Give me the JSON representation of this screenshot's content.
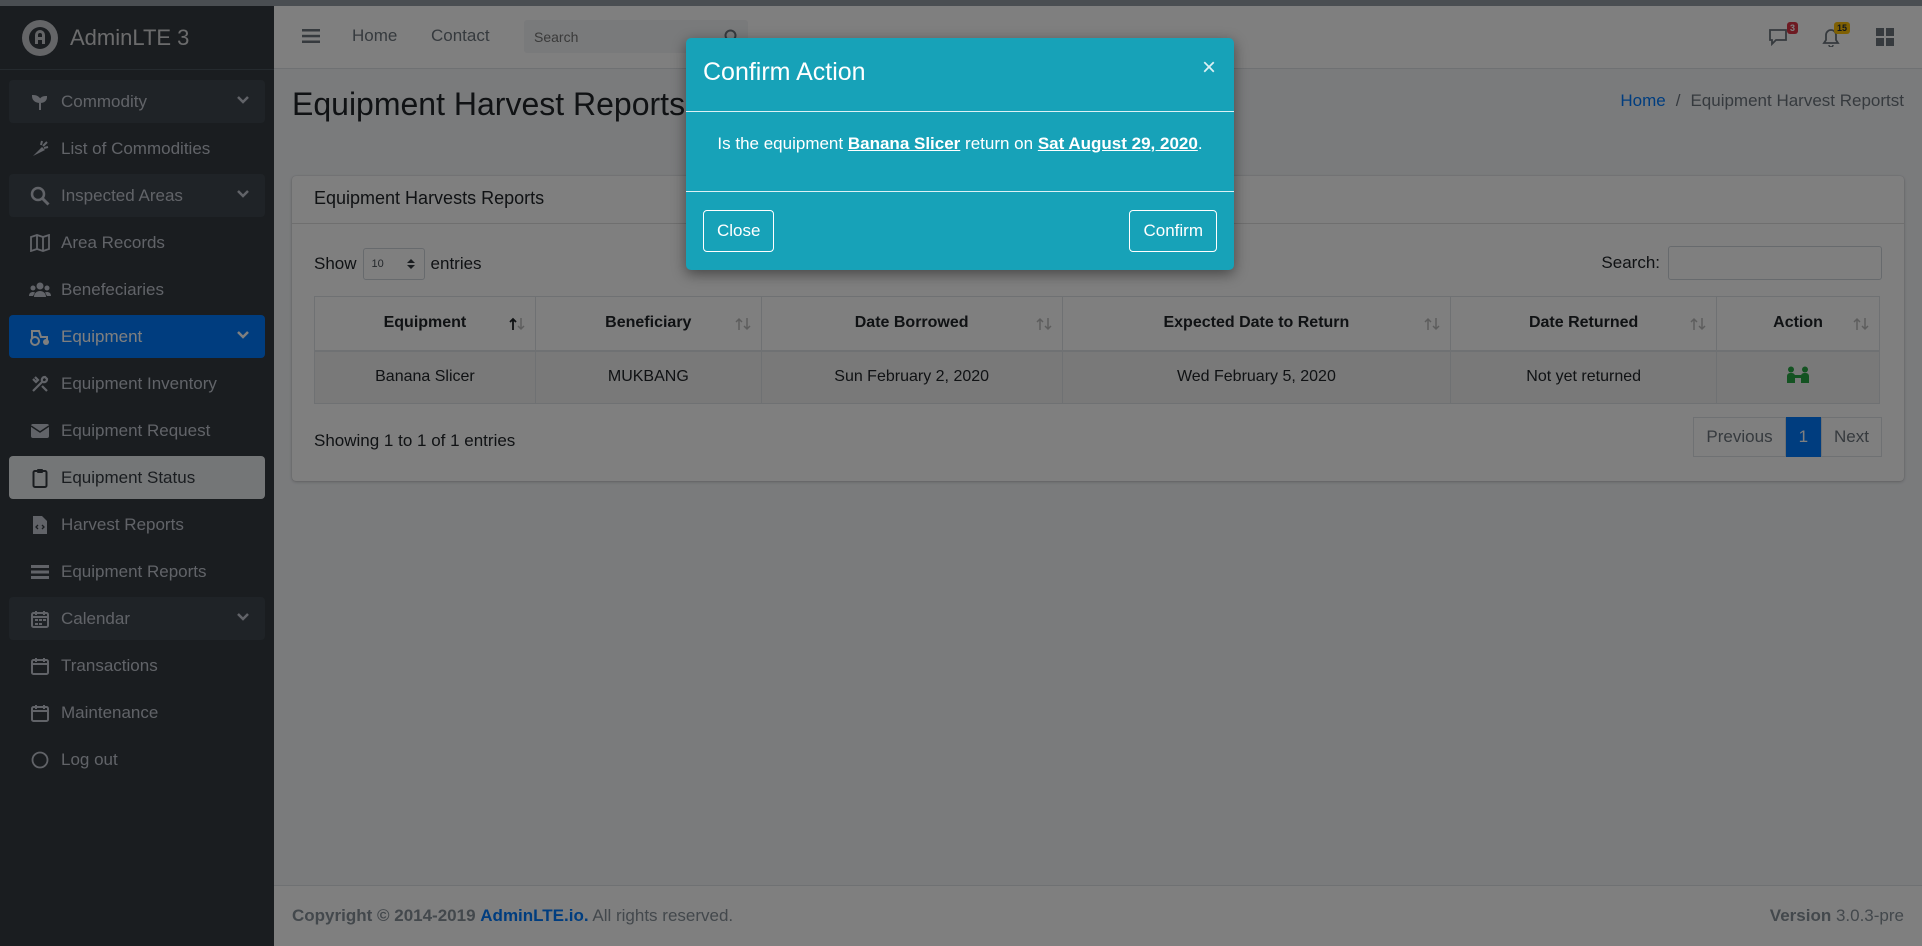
{
  "brand": {
    "name": "AdminLTE 3"
  },
  "sidebar": {
    "items": [
      {
        "label": "Commodity",
        "icon": "seedling-icon"
      },
      {
        "label": "List of Commodities",
        "icon": "carrot-icon"
      },
      {
        "label": "Inspected Areas",
        "icon": "search-icon"
      },
      {
        "label": "Area Records",
        "icon": "map-icon"
      },
      {
        "label": "Benefeciaries",
        "icon": "users-icon"
      },
      {
        "label": "Equipment",
        "icon": "tractor-icon"
      },
      {
        "label": "Equipment Inventory",
        "icon": "tools-icon"
      },
      {
        "label": "Equipment Request",
        "icon": "envelope-icon"
      },
      {
        "label": "Equipment Status",
        "icon": "clipboard-icon"
      },
      {
        "label": "Harvest Reports",
        "icon": "file-code-icon"
      },
      {
        "label": "Equipment Reports",
        "icon": "list-icon"
      },
      {
        "label": "Calendar",
        "icon": "calendar-icon"
      },
      {
        "label": "Transactions",
        "icon": "calendar-icon"
      },
      {
        "label": "Maintenance",
        "icon": "calendar-icon"
      },
      {
        "label": "Log out",
        "icon": "circle-icon"
      }
    ]
  },
  "navbar": {
    "home": "Home",
    "contact": "Contact",
    "search_placeholder": "Search",
    "messages_count": "3",
    "notifications_count": "15"
  },
  "page": {
    "title": "Equipment Harvest Reports",
    "breadcrumb_home": "Home",
    "breadcrumb_sep": "/",
    "breadcrumb_current": "Equipment Harvest Reportst"
  },
  "card": {
    "title": "Equipment Harvests Reports",
    "show_label": "Show",
    "entries_value": "10",
    "entries_label": "entries",
    "search_label": "Search:",
    "columns": [
      "Equipment",
      "Beneficiary",
      "Date Borrowed",
      "Expected Date to Return",
      "Date Returned",
      "Action"
    ],
    "rows": [
      [
        "Banana Slicer",
        "MUKBANG",
        "Sun February 2, 2020",
        "Wed February 5, 2020",
        "Not yet returned"
      ]
    ],
    "info": "Showing 1 to 1 of 1 entries",
    "pager": {
      "previous": "Previous",
      "page": "1",
      "next": "Next"
    }
  },
  "footer": {
    "copyright": "Copyright © 2014-2019",
    "link": "AdminLTE.io.",
    "rights": "All rights reserved.",
    "version_label": "Version",
    "version": "3.0.3-pre"
  },
  "modal": {
    "title": "Confirm Action",
    "close_symbol": "×",
    "text_prefix": "Is the equipment",
    "equipment": "Banana Slicer",
    "text_mid": "return on",
    "date": "Sat August 29, 2020",
    "text_suffix": ".",
    "close_label": "Close",
    "confirm_label": "Confirm"
  },
  "colors": {
    "accent": "#007bff",
    "modal": "#17a2b8",
    "sidebar": "#343a40"
  }
}
